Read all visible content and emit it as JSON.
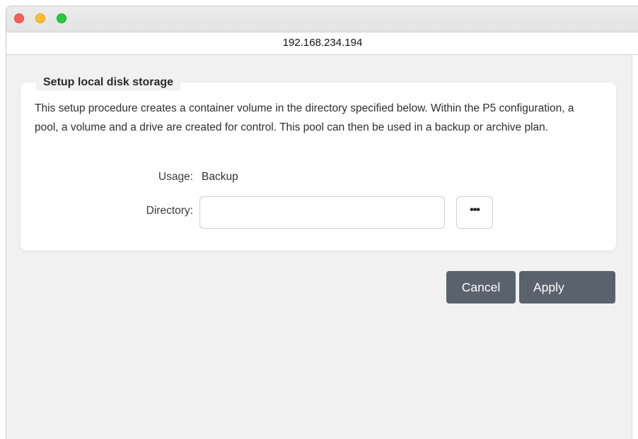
{
  "window": {
    "address": "192.168.234.194"
  },
  "panel": {
    "legend": "Setup local disk storage",
    "description": "This setup procedure creates a container volume in the directory specified below. Within the P5 configuration, a pool, a volume and a drive are created for control. This pool can then be used in a backup or archive plan.",
    "usage_label": "Usage:",
    "usage_value": "Backup",
    "directory_label": "Directory:",
    "directory_value": "",
    "browse_label": "•••"
  },
  "actions": {
    "cancel_label": "Cancel",
    "apply_label": "Apply"
  },
  "colors": {
    "button_bg": "#59626d",
    "page_bg": "#f1f1f2",
    "close": "#ff5f57",
    "minimize": "#febc2e",
    "maximize": "#28c840"
  }
}
